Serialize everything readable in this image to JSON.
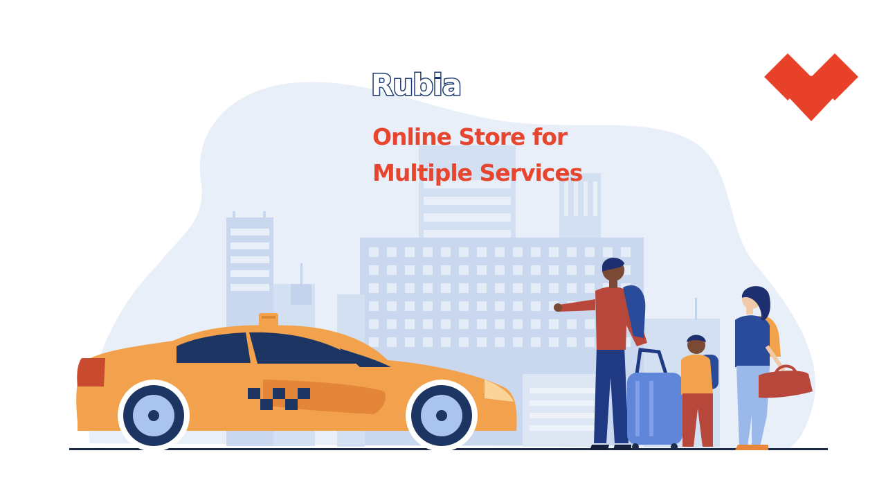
{
  "brand": {
    "name": "Rubia",
    "tagline_line1": "Online Store for",
    "tagline_line2": "Multiple Services"
  },
  "colors": {
    "brand_outline": "#1d3b6e",
    "tagline": "#e8452f",
    "logo_red": "#e8412a",
    "taxi_yellow": "#f2a24c",
    "city_blue": "#dfe8f5",
    "building_blue": "#c7d6ec"
  },
  "icons": {
    "logo": "red-diamond-tiles-logo",
    "illustration": "taxi-and-travelers-illustration"
  }
}
